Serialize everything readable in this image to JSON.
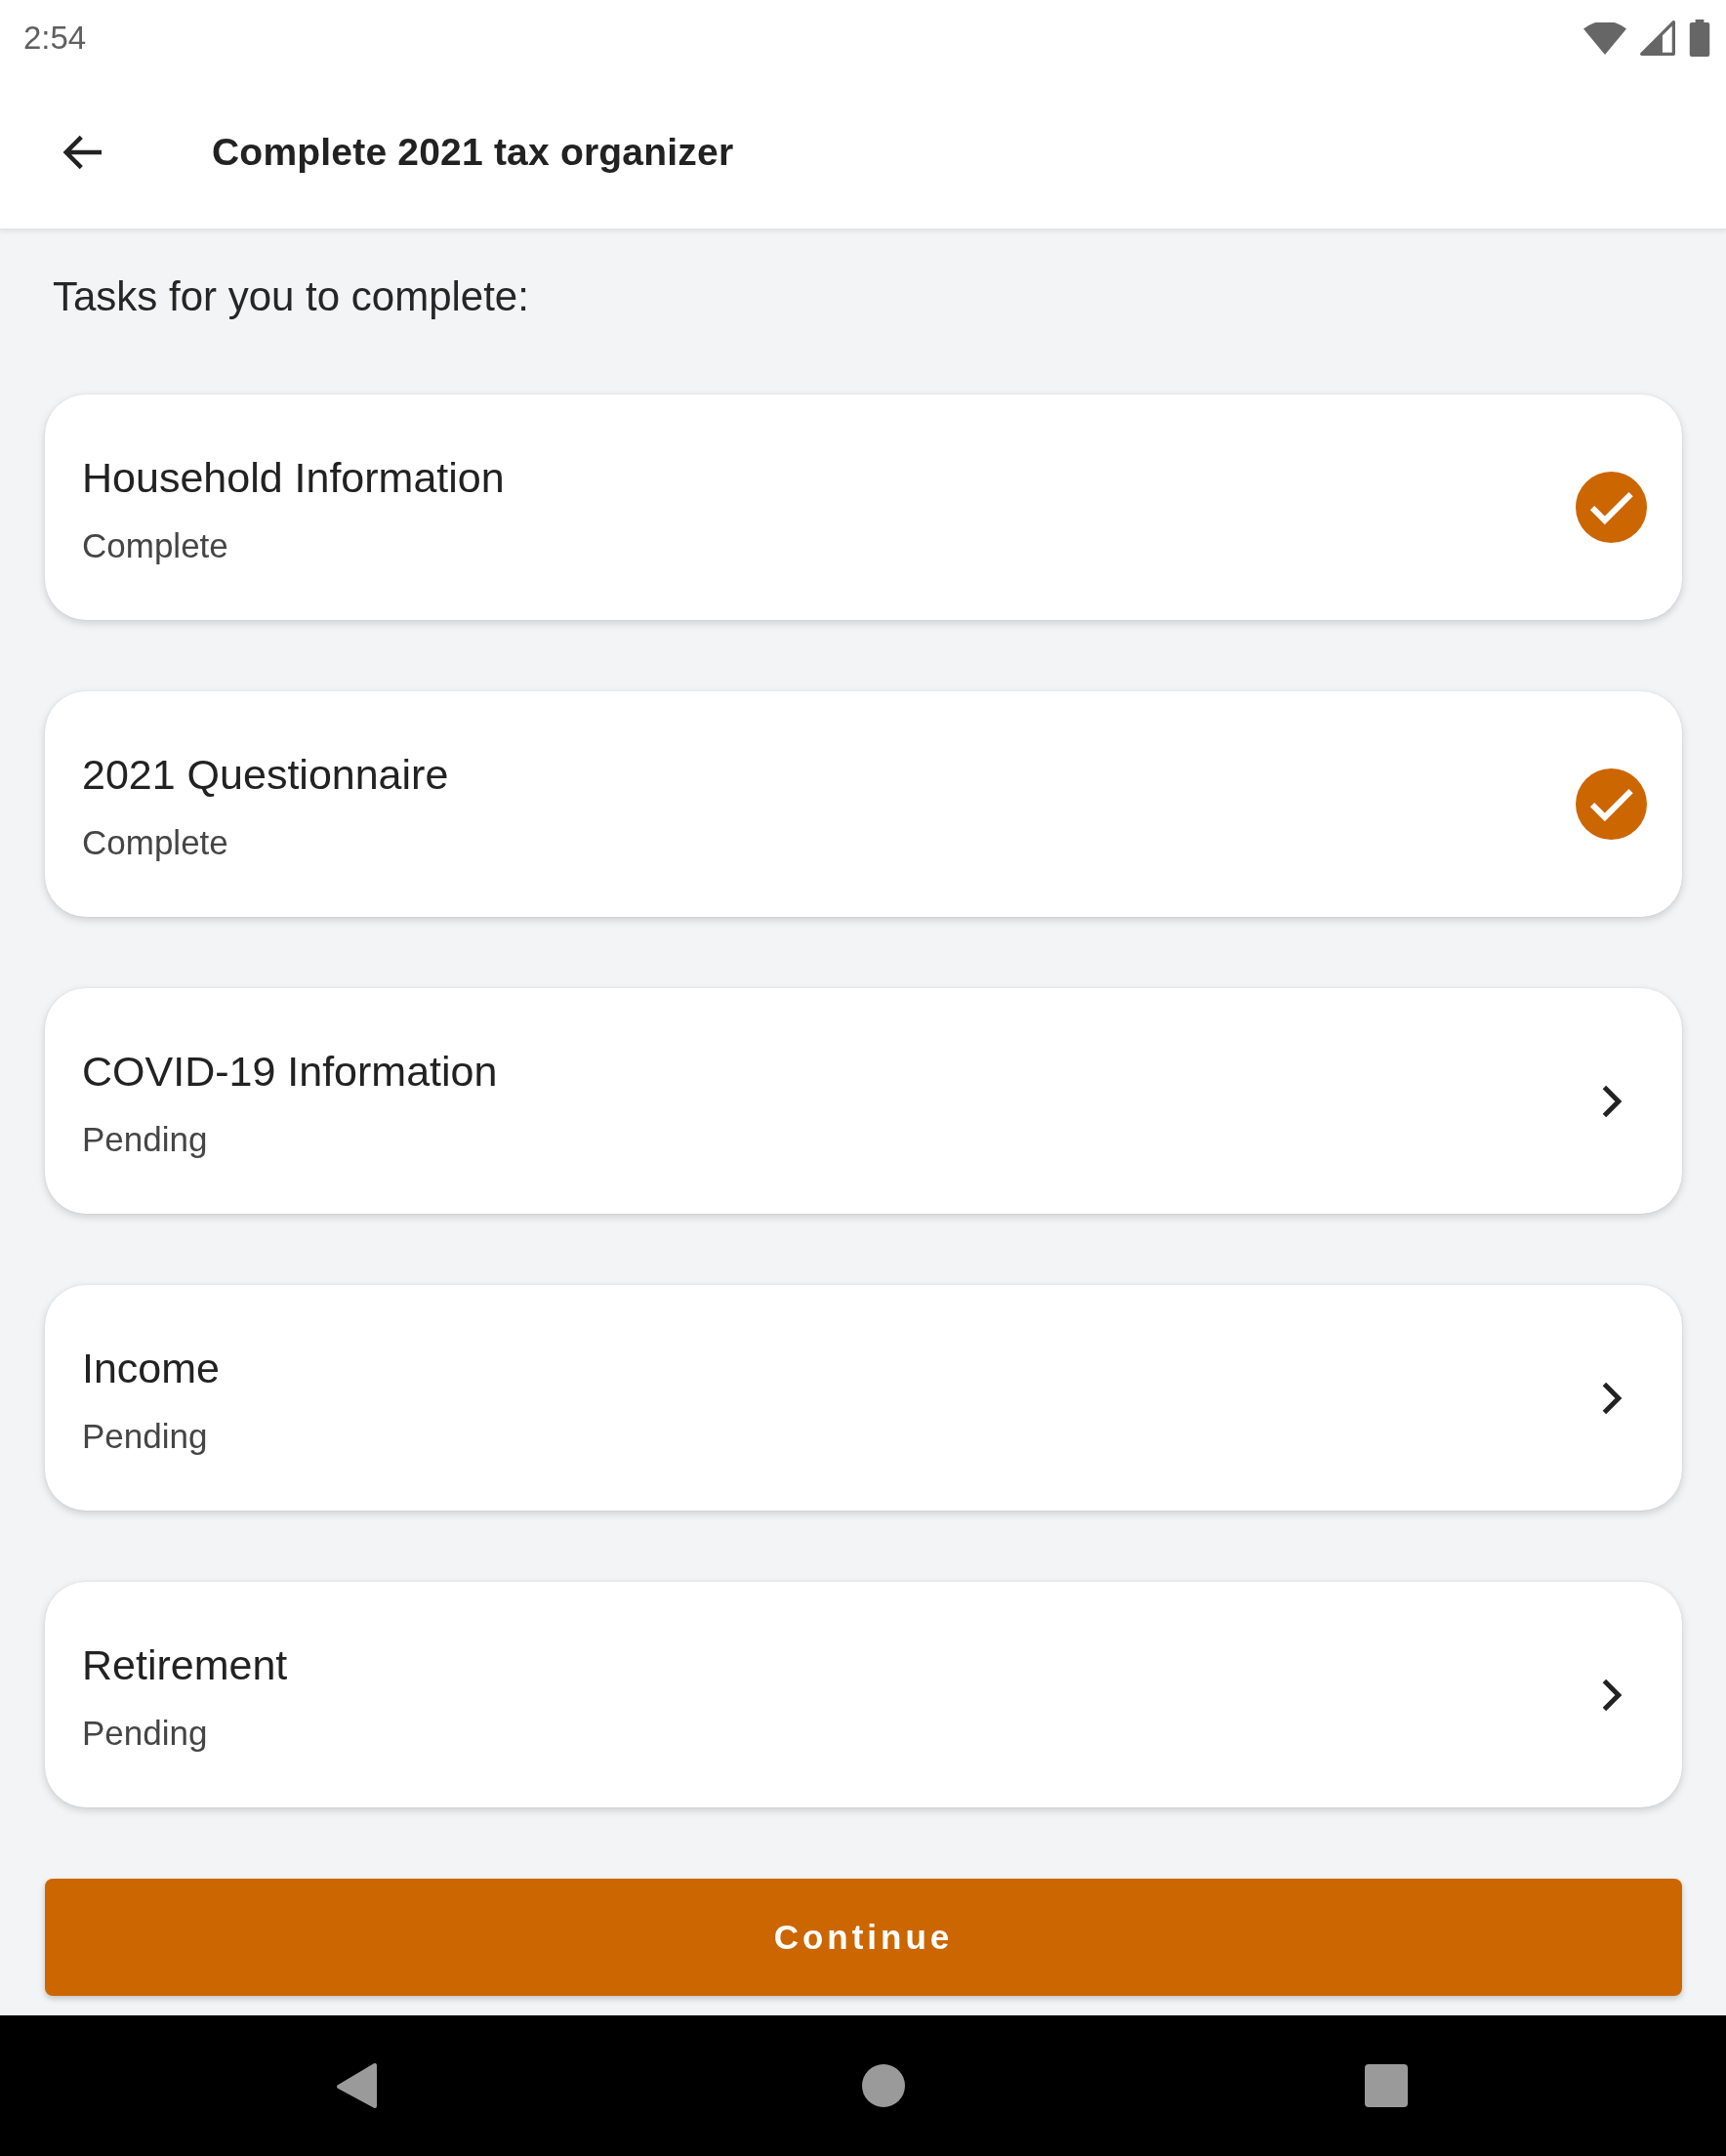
{
  "status_bar": {
    "time": "2:54"
  },
  "app_bar": {
    "title": "Complete 2021 tax organizer"
  },
  "heading": "Tasks for you to complete:",
  "tasks": [
    {
      "title": "Household Information",
      "status": "Complete",
      "completed": true
    },
    {
      "title": "2021 Questionnaire",
      "status": "Complete",
      "completed": true
    },
    {
      "title": "COVID-19 Information",
      "status": "Pending",
      "completed": false
    },
    {
      "title": "Income",
      "status": "Pending",
      "completed": false
    },
    {
      "title": "Retirement",
      "status": "Pending",
      "completed": false
    }
  ],
  "continue_button": {
    "label": "Continue"
  }
}
